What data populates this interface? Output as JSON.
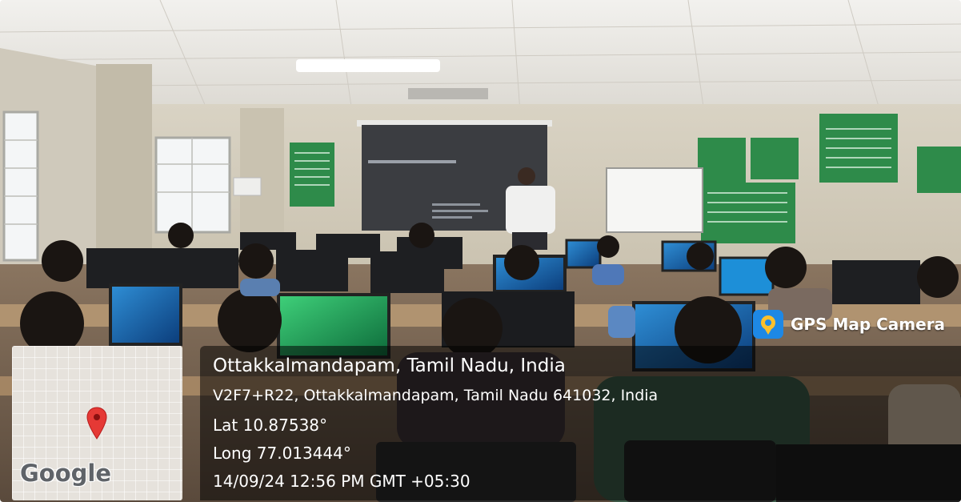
{
  "overlay": {
    "app_name": "GPS Map Camera",
    "location_title": "Ottakkalmandapam, Tamil Nadu, India",
    "address": "V2F7+R22, Ottakkalmandapam, Tamil Nadu 641032, India",
    "latitude": "Lat 10.87538°",
    "longitude": "Long 77.013444°",
    "timestamp": "14/09/24 12:56 PM GMT +05:30"
  },
  "map": {
    "provider_logo": "Google",
    "pin_icon": "location-pin-icon",
    "pin_color": "#e53935"
  },
  "colors": {
    "wall": "#d8d2c4",
    "notice_board": "#2e8b4a",
    "panel": "rgba(0,0,0,0.52)",
    "badge_icon": "#1e88e5"
  }
}
